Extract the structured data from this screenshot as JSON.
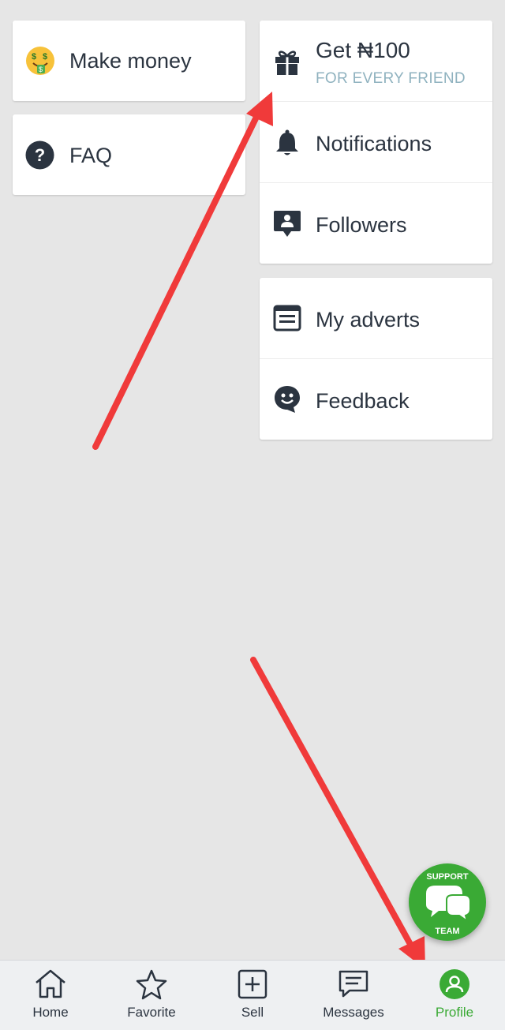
{
  "left_cards": [
    {
      "label": "Make money",
      "icon": "money-mouth-face-icon"
    },
    {
      "label": "FAQ",
      "icon": "question-circle-icon"
    }
  ],
  "right_card_1": {
    "promo": {
      "label": "Get ₦100",
      "sublabel": "FOR EVERY FRIEND",
      "icon": "gift-icon"
    },
    "notifications": {
      "label": "Notifications",
      "icon": "bell-icon"
    },
    "followers": {
      "label": "Followers",
      "icon": "person-speech-bubble-icon"
    }
  },
  "right_card_2": {
    "my_adverts": {
      "label": "My adverts",
      "icon": "list-box-icon"
    },
    "feedback": {
      "label": "Feedback",
      "icon": "smiley-bubble-icon"
    }
  },
  "support_fab": {
    "top_text": "SUPPORT",
    "bottom_text": "TEAM",
    "icon": "chat-bubbles-icon"
  },
  "tabbar": {
    "items": [
      {
        "label": "Home",
        "icon": "home-icon"
      },
      {
        "label": "Favorite",
        "icon": "star-icon"
      },
      {
        "label": "Sell",
        "icon": "plus-square-icon"
      },
      {
        "label": "Messages",
        "icon": "message-icon"
      },
      {
        "label": "Profile",
        "icon": "profile-icon",
        "active": true
      }
    ]
  },
  "colors": {
    "accent_green": "#3aaa35",
    "text": "#2b3440",
    "sub_text": "#8fb2bf",
    "annotation_red": "#f03a3a",
    "background": "#e6e6e6"
  }
}
